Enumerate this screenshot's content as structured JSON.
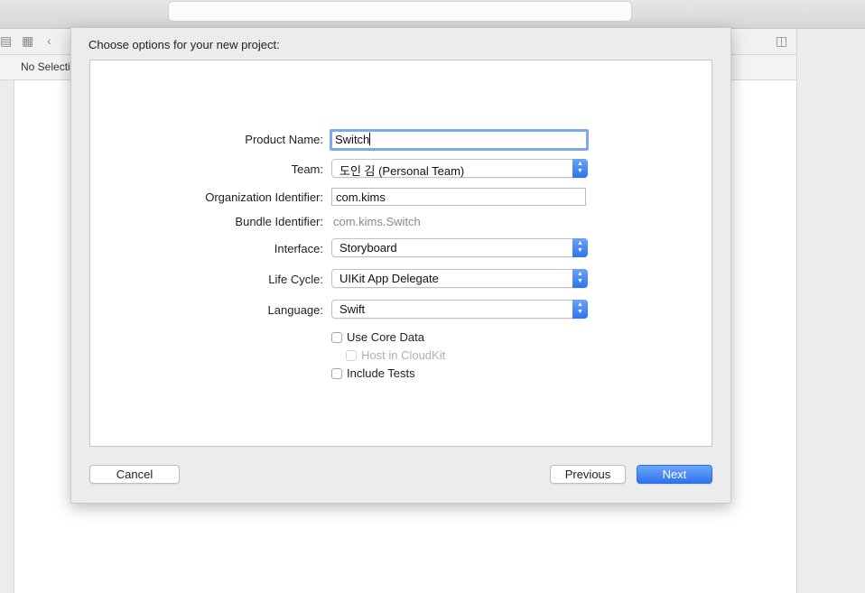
{
  "background": {
    "path_bar": {
      "text": "No Selection"
    }
  },
  "dialog": {
    "title": "Choose options for your new project:",
    "fields": {
      "product_name": {
        "label": "Product Name:",
        "value": "Switch"
      },
      "team": {
        "label": "Team:",
        "value": "도인 김 (Personal Team)"
      },
      "organization_identifier": {
        "label": "Organization Identifier:",
        "value": "com.kims"
      },
      "bundle_identifier": {
        "label": "Bundle Identifier:",
        "value": "com.kims.Switch"
      },
      "interface": {
        "label": "Interface:",
        "value": "Storyboard"
      },
      "life_cycle": {
        "label": "Life Cycle:",
        "value": "UIKit App Delegate"
      },
      "language": {
        "label": "Language:",
        "value": "Swift"
      }
    },
    "options": {
      "use_core_data": {
        "label": "Use Core Data",
        "checked": false
      },
      "host_in_cloudkit": {
        "label": "Host in CloudKit",
        "checked": false,
        "enabled": false
      },
      "include_tests": {
        "label": "Include Tests",
        "checked": false
      }
    },
    "buttons": {
      "cancel": "Cancel",
      "previous": "Previous",
      "next": "Next"
    }
  },
  "colors": {
    "accent": "#2f73f0",
    "focus_ring": "#80a8e8"
  },
  "icons": [
    "navigator-icon",
    "grid-icon",
    "back-chevron-icon",
    "inspector-toggle-icon",
    "popup-arrows-icon"
  ]
}
